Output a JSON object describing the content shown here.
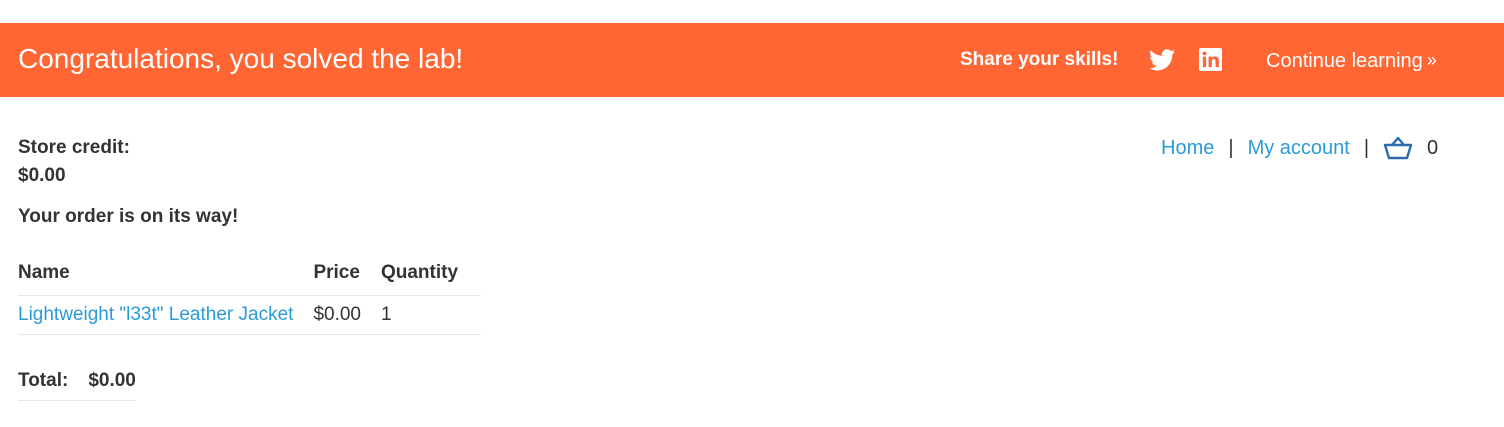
{
  "banner": {
    "message": "Congratulations, you solved the lab!",
    "share_label": "Share your skills!",
    "twitter_icon": "twitter-icon",
    "linkedin_icon": "linkedin-icon",
    "continue_label": "Continue learning",
    "continue_icon": "double-chevron-right-icon",
    "background_color": "#ff6633"
  },
  "account": {
    "store_credit_label": "Store credit:",
    "store_credit_value": "$0.00",
    "order_message": "Your order is on its way!"
  },
  "nav": {
    "home": "Home",
    "separator": "|",
    "my_account": "My account",
    "cart_icon": "basket-icon",
    "cart_count": "0",
    "link_color": "#2b9bd6"
  },
  "order_table": {
    "headers": {
      "name": "Name",
      "price": "Price",
      "quantity": "Quantity"
    },
    "rows": [
      {
        "name": "Lightweight \"l33t\" Leather Jacket",
        "price": "$0.00",
        "quantity": "1"
      }
    ]
  },
  "total": {
    "label": "Total:",
    "value": "$0.00"
  }
}
